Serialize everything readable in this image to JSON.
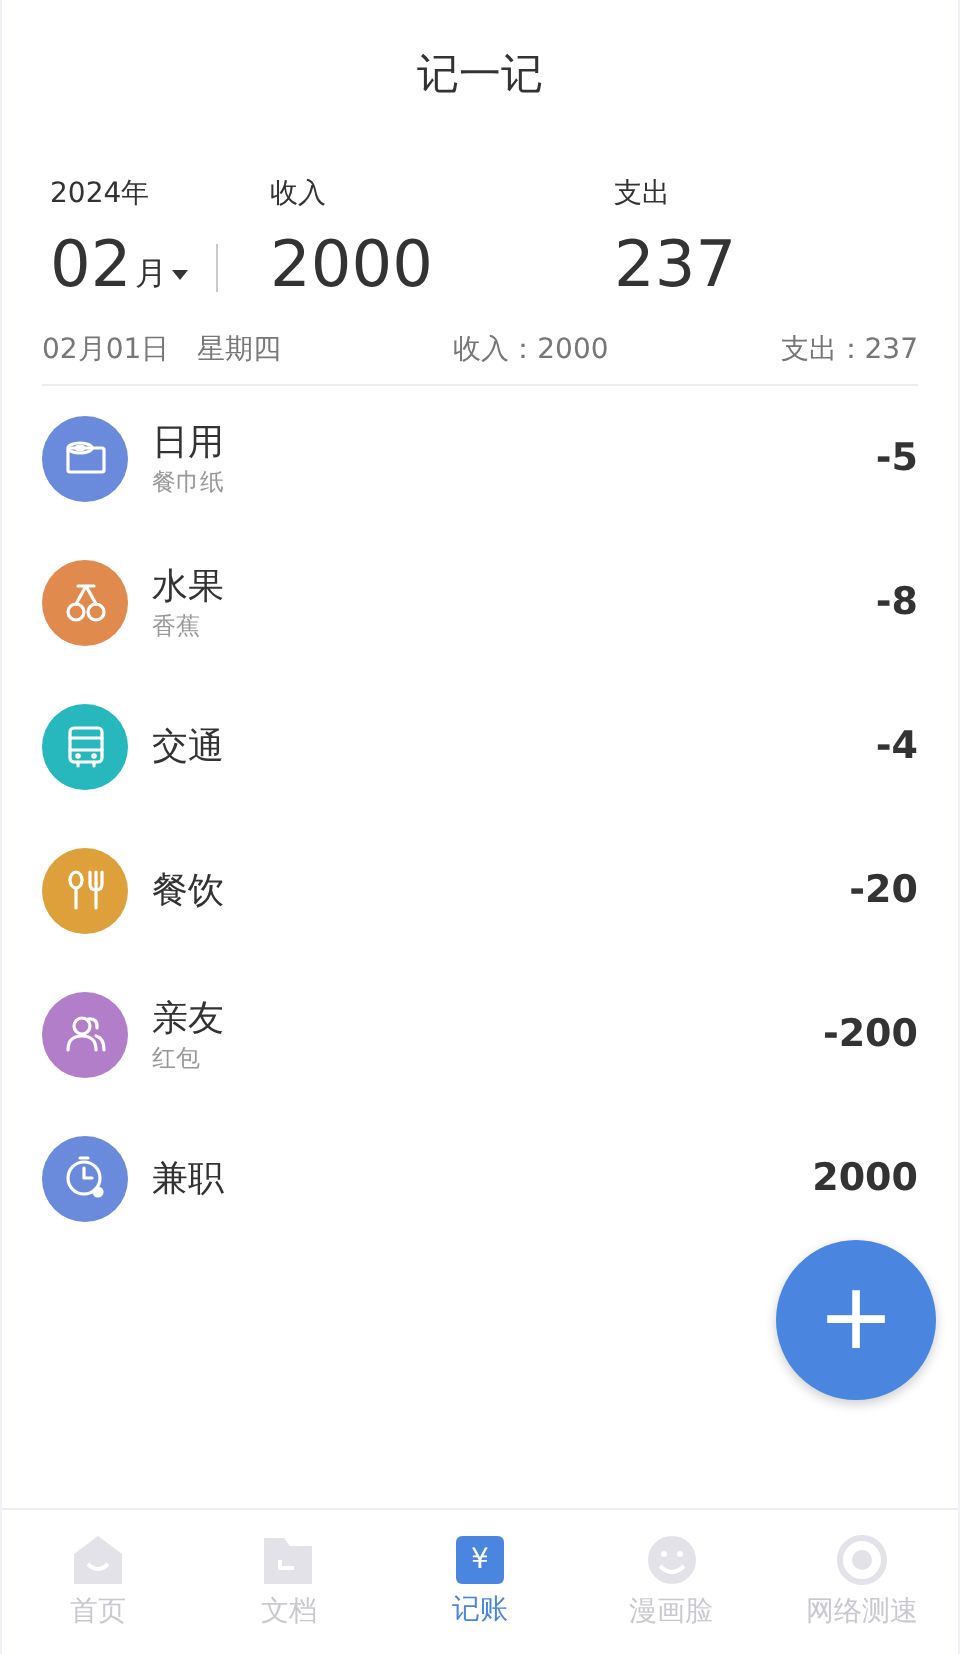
{
  "header": {
    "title": "记一记"
  },
  "summary": {
    "year": "2024年",
    "month": "02",
    "month_unit": "月",
    "income_label": "收入",
    "income": "2000",
    "expense_label": "支出",
    "expense": "237"
  },
  "day": {
    "date": "02月01日",
    "weekday": "星期四",
    "income": "收入：2000",
    "expense": "支出：237"
  },
  "entries": [
    {
      "kind": "tissue",
      "category": "日用",
      "note": "餐巾纸",
      "amount": "-5",
      "color": "#6a8bdb"
    },
    {
      "kind": "cherry",
      "category": "水果",
      "note": "香蕉",
      "amount": "-8",
      "color": "#e08a4e"
    },
    {
      "kind": "bus",
      "category": "交通",
      "amount": "-4",
      "color": "#26b8bd"
    },
    {
      "kind": "dining",
      "category": "餐饮",
      "amount": "-20",
      "color": "#dea03b"
    },
    {
      "kind": "people",
      "category": "亲友",
      "note": "红包",
      "amount": "-200",
      "color": "#b27ec9"
    },
    {
      "kind": "clock",
      "category": "兼职",
      "amount": "2000",
      "color": "#6a8bdb"
    }
  ],
  "add_button": {
    "label": "+"
  },
  "tabs": [
    {
      "kind": "home",
      "label": "首页",
      "selected": false
    },
    {
      "kind": "doc",
      "label": "文档",
      "selected": false
    },
    {
      "kind": "yen",
      "label": "记账",
      "selected": true,
      "icon_text": "¥"
    },
    {
      "kind": "face",
      "label": "漫画脸",
      "selected": false
    },
    {
      "kind": "speed",
      "label": "网络测速",
      "selected": false
    }
  ]
}
